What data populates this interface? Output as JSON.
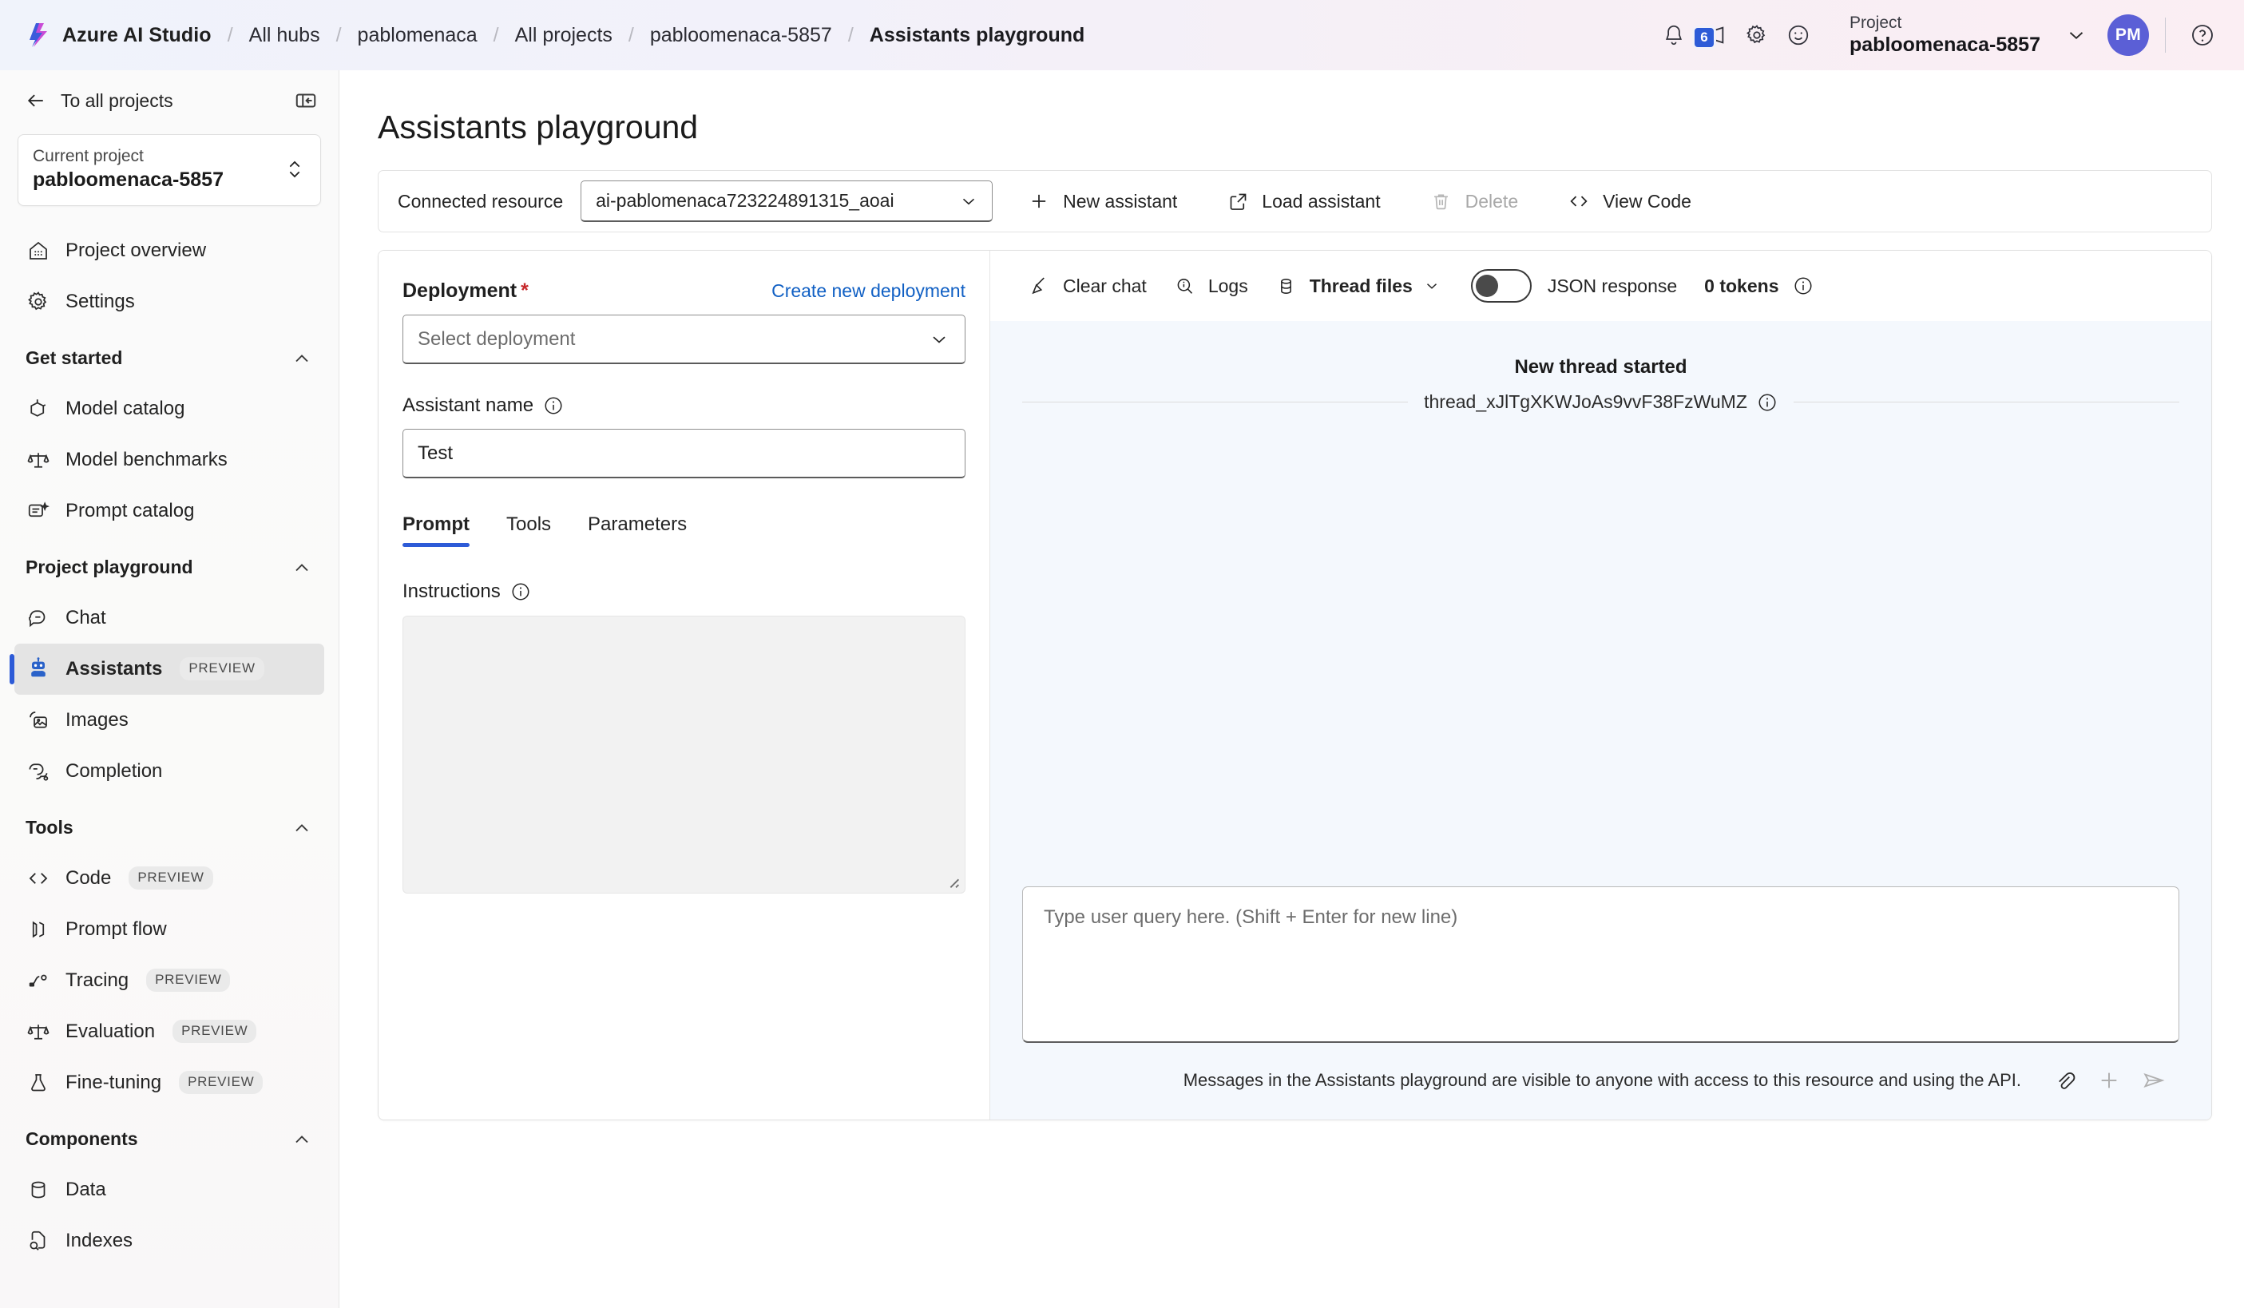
{
  "header": {
    "brand": "Azure AI Studio",
    "breadcrumbs": [
      {
        "label": "All hubs"
      },
      {
        "label": "pablomenaca"
      },
      {
        "label": "All projects"
      },
      {
        "label": "pabloomenaca-5857"
      },
      {
        "label": "Assistants playground"
      }
    ],
    "icons": {
      "bell": "bell-icon",
      "announcement": "megaphone-icon",
      "settings": "gear-icon",
      "feedback": "smiley-icon",
      "help": "help-circle-icon"
    },
    "announcement_badge": "6",
    "project_label": "Project",
    "project_name": "pabloomenaca-5857",
    "avatar_initials": "PM"
  },
  "sidebar": {
    "back_label": "To all projects",
    "collapse_icon": "panel-collapse-icon",
    "current_project_label": "Current project",
    "current_project_value": "pabloomenaca-5857",
    "top_items": [
      {
        "label": "Project overview",
        "icon": "home-icon"
      },
      {
        "label": "Settings",
        "icon": "gear-icon"
      }
    ],
    "groups": [
      {
        "title": "Get started",
        "items": [
          {
            "label": "Model catalog",
            "icon": "cube-icon",
            "badge": ""
          },
          {
            "label": "Model benchmarks",
            "icon": "scales-icon",
            "badge": ""
          },
          {
            "label": "Prompt catalog",
            "icon": "prompt-icon",
            "badge": ""
          }
        ]
      },
      {
        "title": "Project playground",
        "items": [
          {
            "label": "Chat",
            "icon": "chat-icon",
            "badge": ""
          },
          {
            "label": "Assistants",
            "icon": "robot-icon",
            "badge": "PREVIEW",
            "selected": true
          },
          {
            "label": "Images",
            "icon": "image-icon",
            "badge": ""
          },
          {
            "label": "Completion",
            "icon": "completion-icon",
            "badge": ""
          }
        ]
      },
      {
        "title": "Tools",
        "items": [
          {
            "label": "Code",
            "icon": "code-icon",
            "badge": "PREVIEW"
          },
          {
            "label": "Prompt flow",
            "icon": "flow-icon",
            "badge": ""
          },
          {
            "label": "Tracing",
            "icon": "tracing-icon",
            "badge": "PREVIEW"
          },
          {
            "label": "Evaluation",
            "icon": "scales-icon",
            "badge": "PREVIEW"
          },
          {
            "label": "Fine-tuning",
            "icon": "flask-icon",
            "badge": "PREVIEW"
          }
        ]
      },
      {
        "title": "Components",
        "items": [
          {
            "label": "Data",
            "icon": "database-icon",
            "badge": ""
          },
          {
            "label": "Indexes",
            "icon": "index-search-icon",
            "badge": ""
          }
        ]
      }
    ]
  },
  "main": {
    "page_title": "Assistants playground",
    "toolbar": {
      "connected_resource_label": "Connected resource",
      "connected_resource_value": "ai-pablomenaca723224891315_aoai",
      "new_assistant": "New assistant",
      "load_assistant": "Load assistant",
      "delete": "Delete",
      "view_code": "View Code"
    },
    "config": {
      "deployment_label": "Deployment",
      "required_mark": "*",
      "create_new_deployment": "Create new deployment",
      "deployment_placeholder": "Select deployment",
      "assistant_name_label": "Assistant name",
      "assistant_name_value": "Test",
      "tabs": [
        {
          "label": "Prompt",
          "active": true
        },
        {
          "label": "Tools",
          "active": false
        },
        {
          "label": "Parameters",
          "active": false
        }
      ],
      "instructions_label": "Instructions",
      "instructions_value": ""
    },
    "chat": {
      "clear_chat": "Clear chat",
      "logs": "Logs",
      "thread_files": "Thread files",
      "json_response": "JSON response",
      "json_response_enabled": false,
      "tokens": "0 tokens",
      "new_thread_started": "New thread started",
      "thread_id": "thread_xJlTgXKWJoAs9vvF38FzWuMZ",
      "composer_placeholder": "Type user query here. (Shift + Enter for new line)",
      "composer_value": "",
      "disclaimer": "Messages in the Assistants playground are visible to anyone with access to this resource and using the API.",
      "attach_icon": "paperclip-icon",
      "add_icon": "plus-icon",
      "send_icon": "send-icon"
    }
  },
  "colors": {
    "accent": "#2d5bd7",
    "link": "#1160c4",
    "required": "#c6282b",
    "avatar": "#5b5fd6",
    "chat_bg": "#f4f8fd"
  }
}
